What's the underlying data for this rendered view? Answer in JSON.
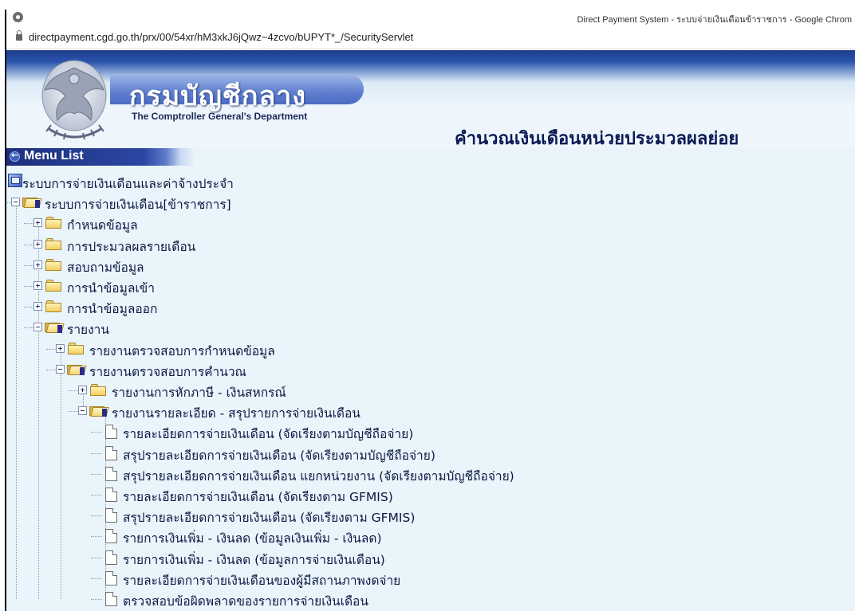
{
  "window": {
    "title": "Direct Payment System - ระบบจ่ายเงินเดือนข้าราชการ - Google Chrom",
    "url": "directpayment.cgd.go.th/prx/00/54xr/hM3xkJ6jQwz~4zcvo/bUPYT*_/SecurityServlet"
  },
  "header": {
    "brand_th": "กรมบัญชีกลาง",
    "brand_en": "The Comptroller General's Department",
    "page_title": "คำนวณเงินเดือนหน่วยประมวลผลย่อย"
  },
  "menu": {
    "label": "Menu List",
    "tree": [
      {
        "label": "ระบบการจ่ายเงินเดือนและค่าจ้างประจำ",
        "type": "system"
      },
      {
        "label": "ระบบการจ่ายเงินเดือน[ข้าราชการ]",
        "type": "folder-open"
      },
      {
        "label": "กำหนดข้อมูล",
        "type": "folder"
      },
      {
        "label": "การประมวลผลรายเดือน",
        "type": "folder"
      },
      {
        "label": "สอบถามข้อมูล",
        "type": "folder"
      },
      {
        "label": "การนำข้อมูลเข้า",
        "type": "folder"
      },
      {
        "label": "การนำข้อมูลออก",
        "type": "folder"
      },
      {
        "label": "รายงาน",
        "type": "folder-open"
      },
      {
        "label": "รายงานตรวจสอบการกำหนดข้อมูล",
        "type": "folder"
      },
      {
        "label": "รายงานตรวจสอบการคำนวณ",
        "type": "folder-open"
      },
      {
        "label": "รายงานการหักภาษี - เงินสหกรณ์",
        "type": "folder"
      },
      {
        "label": "รายงานรายละเอียด - สรุปรายการจ่ายเงินเดือน",
        "type": "folder-open"
      },
      {
        "label": "รายละเอียดการจ่ายเงินเดือน (จัดเรียงตามบัญชีถือจ่าย)",
        "type": "page"
      },
      {
        "label": "สรุปรายละเอียดการจ่ายเงินเดือน (จัดเรียงตามบัญชีถือจ่าย)",
        "type": "page"
      },
      {
        "label": "สรุปรายละเอียดการจ่ายเงินเดือน แยกหน่วยงาน (จัดเรียงตามบัญชีถือจ่าย)",
        "type": "page"
      },
      {
        "label": "รายละเอียดการจ่ายเงินเดือน (จัดเรียงตาม GFMIS)",
        "type": "page"
      },
      {
        "label": "สรุปรายละเอียดการจ่ายเงินเดือน (จัดเรียงตาม GFMIS)",
        "type": "page"
      },
      {
        "label": "รายการเงินเพิ่ม - เงินลด (ข้อมูลเงินเพิ่ม - เงินลด)",
        "type": "page"
      },
      {
        "label": "รายการเงินเพิ่ม - เงินลด (ข้อมูลการจ่ายเงินเดือน)",
        "type": "page"
      },
      {
        "label": "รายละเอียดการจ่ายเงินเดือนของผู้มีสถานภาพงดจ่าย",
        "type": "page"
      },
      {
        "label": "ตรวจสอบข้อผิดพลาดของรายการจ่ายเงินเดือน",
        "type": "page"
      }
    ]
  }
}
